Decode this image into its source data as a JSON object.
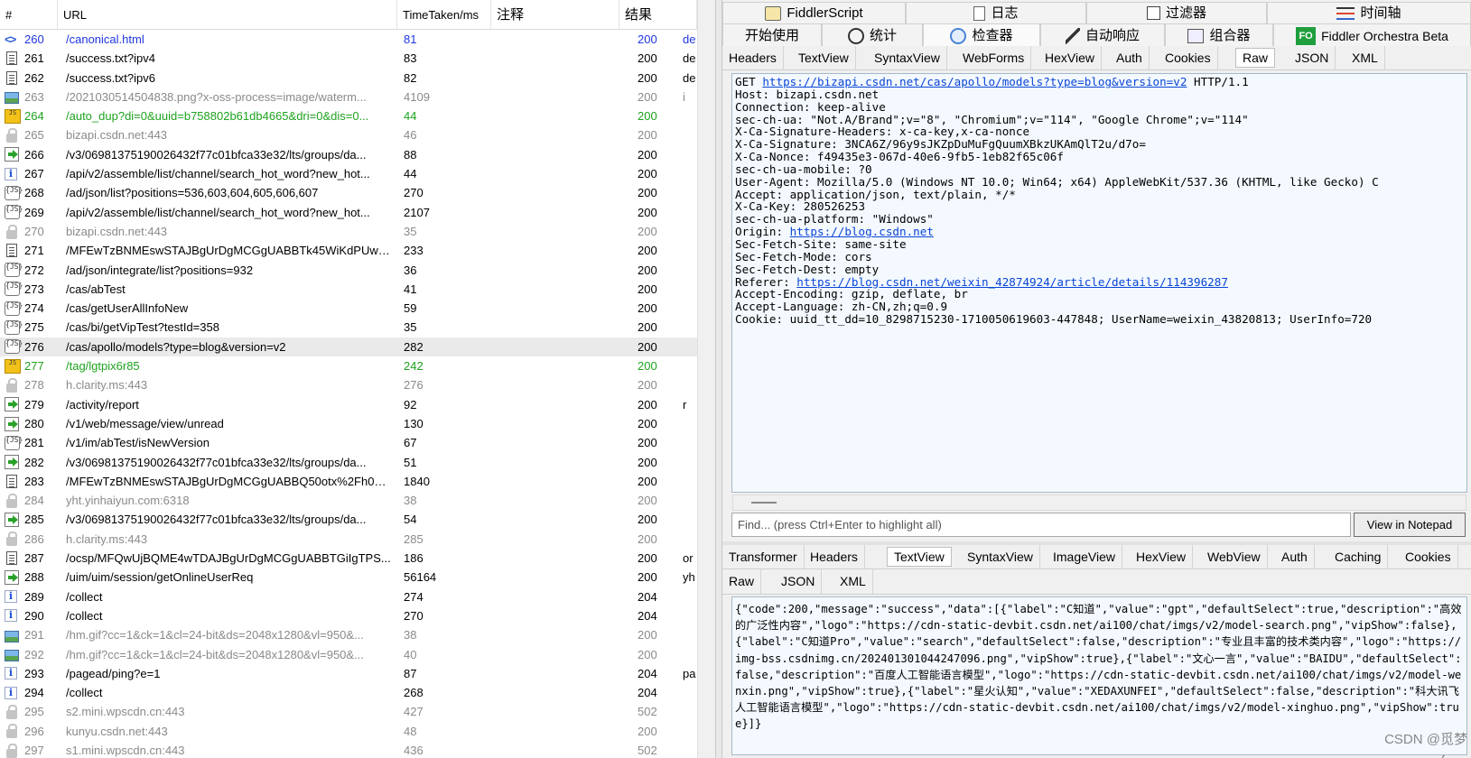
{
  "list": {
    "columns": [
      "#",
      "URL",
      "TimeTaken/ms",
      "注释",
      "结果"
    ],
    "selected_row": 276,
    "rows": [
      {
        "icon": "link",
        "num": "260",
        "url": "/canonical.html",
        "time": "81",
        "result": "200",
        "extra": "de",
        "style": "blue"
      },
      {
        "icon": "doc",
        "num": "261",
        "url": "/success.txt?ipv4",
        "time": "83",
        "result": "200",
        "extra": "de",
        "style": ""
      },
      {
        "icon": "doc",
        "num": "262",
        "url": "/success.txt?ipv6",
        "time": "82",
        "result": "200",
        "extra": "de",
        "style": ""
      },
      {
        "icon": "img",
        "num": "263",
        "url": "/2021030514504838.png?x-oss-process=image/waterm...",
        "time": "4109",
        "result": "200",
        "extra": "i",
        "style": "gray"
      },
      {
        "icon": "jsy",
        "num": "264",
        "url": "/auto_dup?di=0&uuid=b758802b61db4665&dri=0&dis=0...",
        "time": "44",
        "result": "200",
        "extra": "",
        "style": "green"
      },
      {
        "icon": "lock",
        "num": "265",
        "url": "bizapi.csdn.net:443",
        "time": "46",
        "result": "200",
        "extra": "",
        "style": "gray"
      },
      {
        "icon": "arrow",
        "num": "266",
        "url": "/v3/06981375190026432f77c01bfca33e32/lts/groups/da...",
        "time": "88",
        "result": "200",
        "extra": "",
        "style": ""
      },
      {
        "icon": "info",
        "num": "267",
        "url": "/api/v2/assemble/list/channel/search_hot_word?new_hot...",
        "time": "44",
        "result": "200",
        "extra": "",
        "style": ""
      },
      {
        "icon": "js",
        "num": "268",
        "url": "/ad/json/list?positions=536,603,604,605,606,607",
        "time": "270",
        "result": "200",
        "extra": "",
        "style": ""
      },
      {
        "icon": "js",
        "num": "269",
        "url": "/api/v2/assemble/list/channel/search_hot_word?new_hot...",
        "time": "2107",
        "result": "200",
        "extra": "",
        "style": ""
      },
      {
        "icon": "lock",
        "num": "270",
        "url": "bizapi.csdn.net:443",
        "time": "35",
        "result": "200",
        "extra": "",
        "style": "gray"
      },
      {
        "icon": "doc",
        "num": "271",
        "url": "/MFEwTzBNMEswSTAJBgUrDgMCGgUABBTk45WiKdPUwc...",
        "time": "233",
        "result": "200",
        "extra": "",
        "style": ""
      },
      {
        "icon": "js",
        "num": "272",
        "url": "/ad/json/integrate/list?positions=932",
        "time": "36",
        "result": "200",
        "extra": "",
        "style": ""
      },
      {
        "icon": "js",
        "num": "273",
        "url": "/cas/abTest",
        "time": "41",
        "result": "200",
        "extra": "",
        "style": ""
      },
      {
        "icon": "js",
        "num": "274",
        "url": "/cas/getUserAllInfoNew",
        "time": "59",
        "result": "200",
        "extra": "",
        "style": ""
      },
      {
        "icon": "js",
        "num": "275",
        "url": "/cas/bi/getVipTest?testId=358",
        "time": "35",
        "result": "200",
        "extra": "",
        "style": ""
      },
      {
        "icon": "js",
        "num": "276",
        "url": "/cas/apollo/models?type=blog&version=v2",
        "time": "282",
        "result": "200",
        "extra": "",
        "style": ""
      },
      {
        "icon": "jsy",
        "num": "277",
        "url": "/tag/lgtpix6r85",
        "time": "242",
        "result": "200",
        "extra": "",
        "style": "green"
      },
      {
        "icon": "lock",
        "num": "278",
        "url": "h.clarity.ms:443",
        "time": "276",
        "result": "200",
        "extra": "",
        "style": "gray"
      },
      {
        "icon": "arrow",
        "num": "279",
        "url": "/activity/report",
        "time": "92",
        "result": "200",
        "extra": "r",
        "style": ""
      },
      {
        "icon": "arrow",
        "num": "280",
        "url": "/v1/web/message/view/unread",
        "time": "130",
        "result": "200",
        "extra": "",
        "style": ""
      },
      {
        "icon": "js",
        "num": "281",
        "url": "/v1/im/abTest/isNewVersion",
        "time": "67",
        "result": "200",
        "extra": "",
        "style": ""
      },
      {
        "icon": "arrow",
        "num": "282",
        "url": "/v3/06981375190026432f77c01bfca33e32/lts/groups/da...",
        "time": "51",
        "result": "200",
        "extra": "",
        "style": ""
      },
      {
        "icon": "doc",
        "num": "283",
        "url": "/MFEwTzBNMEswSTAJBgUrDgMCGgUABBQ50otx%2Fh0Z...",
        "time": "1840",
        "result": "200",
        "extra": "",
        "style": ""
      },
      {
        "icon": "lock",
        "num": "284",
        "url": "yht.yinhaiyun.com:6318",
        "time": "38",
        "result": "200",
        "extra": "",
        "style": "gray"
      },
      {
        "icon": "arrow",
        "num": "285",
        "url": "/v3/06981375190026432f77c01bfca33e32/lts/groups/da...",
        "time": "54",
        "result": "200",
        "extra": "",
        "style": ""
      },
      {
        "icon": "lock",
        "num": "286",
        "url": "h.clarity.ms:443",
        "time": "285",
        "result": "200",
        "extra": "",
        "style": "gray"
      },
      {
        "icon": "doc",
        "num": "287",
        "url": "/ocsp/MFQwUjBQME4wTDAJBgUrDgMCGgUABBTGiIgTPS...",
        "time": "186",
        "result": "200",
        "extra": "or",
        "style": ""
      },
      {
        "icon": "arrow",
        "num": "288",
        "url": "/uim/uim/session/getOnlineUserReq",
        "time": "56164",
        "result": "200",
        "extra": "yh",
        "style": ""
      },
      {
        "icon": "info",
        "num": "289",
        "url": "/collect",
        "time": "274",
        "result": "204",
        "extra": "",
        "style": ""
      },
      {
        "icon": "info",
        "num": "290",
        "url": "/collect",
        "time": "270",
        "result": "204",
        "extra": "",
        "style": ""
      },
      {
        "icon": "img",
        "num": "291",
        "url": "/hm.gif?cc=1&ck=1&cl=24-bit&ds=2048x1280&vl=950&...",
        "time": "38",
        "result": "200",
        "extra": "",
        "style": "gray"
      },
      {
        "icon": "img",
        "num": "292",
        "url": "/hm.gif?cc=1&ck=1&cl=24-bit&ds=2048x1280&vl=950&...",
        "time": "40",
        "result": "200",
        "extra": "",
        "style": "gray"
      },
      {
        "icon": "info",
        "num": "293",
        "url": "/pagead/ping?e=1",
        "time": "87",
        "result": "204",
        "extra": "pa",
        "style": ""
      },
      {
        "icon": "info",
        "num": "294",
        "url": "/collect",
        "time": "268",
        "result": "204",
        "extra": "",
        "style": ""
      },
      {
        "icon": "lock",
        "num": "295",
        "url": "s2.mini.wpscdn.cn:443",
        "time": "427",
        "result": "502",
        "extra": "",
        "style": "gray"
      },
      {
        "icon": "lock",
        "num": "296",
        "url": "kunyu.csdn.net:443",
        "time": "48",
        "result": "200",
        "extra": "",
        "style": "gray"
      },
      {
        "icon": "lock",
        "num": "297",
        "url": "s1.mini.wpscdn.cn:443",
        "time": "436",
        "result": "502",
        "extra": "",
        "style": "gray"
      }
    ]
  },
  "toptabs_row1": [
    {
      "label": "FiddlerScript",
      "icon": "script"
    },
    {
      "label": "日志",
      "icon": "log"
    },
    {
      "label": "过滤器",
      "icon": "filter"
    },
    {
      "label": "时间轴",
      "icon": "timeline"
    }
  ],
  "toptabs_row2": [
    {
      "label": "开始使用",
      "icon": ""
    },
    {
      "label": "统计",
      "icon": "stats"
    },
    {
      "label": "检查器",
      "icon": "inspector"
    },
    {
      "label": "自动响应",
      "icon": "autoresponder"
    },
    {
      "label": "组合器",
      "icon": "composer"
    },
    {
      "label": "Fiddler Orchestra Beta",
      "icon": "fo",
      "icon_text": "FO"
    }
  ],
  "request_tabs": [
    "Headers",
    "TextView",
    "SyntaxView",
    "WebForms",
    "HexView",
    "Auth",
    "Cookies",
    "Raw",
    "JSON",
    "XML"
  ],
  "request_active_tab": "Raw",
  "request": {
    "method": "GET",
    "url": "https://bizapi.csdn.net/cas/apollo/models?type=blog&version=v2",
    "protocol": "HTTP/1.1",
    "lines_a": [
      "Host: bizapi.csdn.net",
      "Connection: keep-alive",
      "sec-ch-ua: \"Not.A/Brand\";v=\"8\", \"Chromium\";v=\"114\", \"Google Chrome\";v=\"114\"",
      "X-Ca-Signature-Headers: x-ca-key,x-ca-nonce",
      "X-Ca-Signature: 3NCA6Z/96y9sJKZpDuMuFgQuumXBkzUKAmQlT2u/d7o=",
      "X-Ca-Nonce: f49435e3-067d-40e6-9fb5-1eb82f65c06f",
      "sec-ch-ua-mobile: ?0",
      "User-Agent: Mozilla/5.0 (Windows NT 10.0; Win64; x64) AppleWebKit/537.36 (KHTML, like Gecko) C",
      "Accept: application/json, text/plain, */*",
      "X-Ca-Key: 280526253",
      "sec-ch-ua-platform: \"Windows\""
    ],
    "origin_label": "Origin: ",
    "origin_url": "https://blog.csdn.net",
    "lines_b": [
      "Sec-Fetch-Site: same-site",
      "Sec-Fetch-Mode: cors",
      "Sec-Fetch-Dest: empty"
    ],
    "referer_label": "Referer: ",
    "referer_url": "https://blog.csdn.net/weixin_42874924/article/details/114396287",
    "lines_c": [
      "Accept-Encoding: gzip, deflate, br",
      "Accept-Language: zh-CN,zh;q=0.9",
      "Cookie: uuid_tt_dd=10_8298715230-1710050619603-447848; UserName=weixin_43820813; UserInfo=720"
    ]
  },
  "find": {
    "placeholder": "Find... (press Ctrl+Enter to highlight all)",
    "button": "View in Notepad"
  },
  "response_tabs_row1": [
    "Transformer",
    "Headers",
    "TextView",
    "SyntaxView",
    "ImageView",
    "HexView",
    "WebView",
    "Auth",
    "Caching",
    "Cookies"
  ],
  "response_tabs_row2": [
    "Raw",
    "JSON",
    "XML"
  ],
  "response_active_tab": "TextView",
  "response_body": "{\"code\":200,\"message\":\"success\",\"data\":[{\"label\":\"C知道\",\"value\":\"gpt\",\"defaultSelect\":true,\"description\":\"高效的广泛性内容\",\"logo\":\"https://cdn-static-devbit.csdn.net/ai100/chat/imgs/v2/model-search.png\",\"vipShow\":false},{\"label\":\"C知道Pro\",\"value\":\"search\",\"defaultSelect\":false,\"description\":\"专业且丰富的技术类内容\",\"logo\":\"https://img-bss.csdnimg.cn/202401301044247096.png\",\"vipShow\":true},{\"label\":\"文心一言\",\"value\":\"BAIDU\",\"defaultSelect\":false,\"description\":\"百度人工智能语言模型\",\"logo\":\"https://cdn-static-devbit.csdn.net/ai100/chat/imgs/v2/model-wenxin.png\",\"vipShow\":true},{\"label\":\"星火认知\",\"value\":\"XEDAXUNFEI\",\"defaultSelect\":false,\"description\":\"科大讯飞人工智能语言模型\",\"logo\":\"https://cdn-static-devbit.csdn.net/ai100/chat/imgs/v2/model-xinghuo.png\",\"vipShow\":true}]}",
  "watermark": "CSDN @觅梦_feng",
  "colors": {
    "url_blue": "#1f36e0",
    "green": "#1fa31f",
    "gray": "#8a8a8a",
    "link": "#0a45d6",
    "pane_bg": "#f3f9fe"
  }
}
